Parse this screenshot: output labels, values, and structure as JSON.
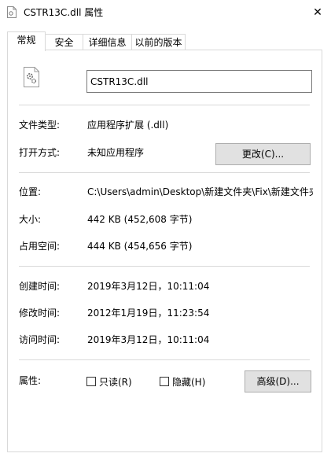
{
  "window": {
    "title": "CSTR13C.dll 属性",
    "close_glyph": "✕"
  },
  "tabs": [
    {
      "label": "常规",
      "active": true
    },
    {
      "label": "安全",
      "active": false
    },
    {
      "label": "详细信息",
      "active": false
    },
    {
      "label": "以前的版本",
      "active": false
    }
  ],
  "general": {
    "file_icon": "dll-file-gear-icon",
    "file_name": "CSTR13C.dll",
    "file_type_label": "文件类型:",
    "file_type_value": "应用程序扩展 (.dll)",
    "opens_with_label": "打开方式:",
    "opens_with_value": "未知应用程序",
    "change_button": "更改(C)...",
    "location_label": "位置:",
    "location_value": "C:\\Users\\admin\\Desktop\\新建文件夹\\Fix\\新建文件夹",
    "size_label": "大小:",
    "size_value": "442 KB (452,608 字节)",
    "size_on_disk_label": "占用空间:",
    "size_on_disk_value": "444 KB (454,656 字节)",
    "created_label": "创建时间:",
    "created_value": "2019年3月12日，10:11:04",
    "modified_label": "修改时间:",
    "modified_value": "2012年1月19日，11:23:54",
    "accessed_label": "访问时间:",
    "accessed_value": "2019年3月12日，10:11:04",
    "attributes_label": "属性:",
    "readonly_label": "只读(R)",
    "readonly_checked": false,
    "hidden_label": "隐藏(H)",
    "hidden_checked": false,
    "advanced_button": "高级(D)..."
  }
}
